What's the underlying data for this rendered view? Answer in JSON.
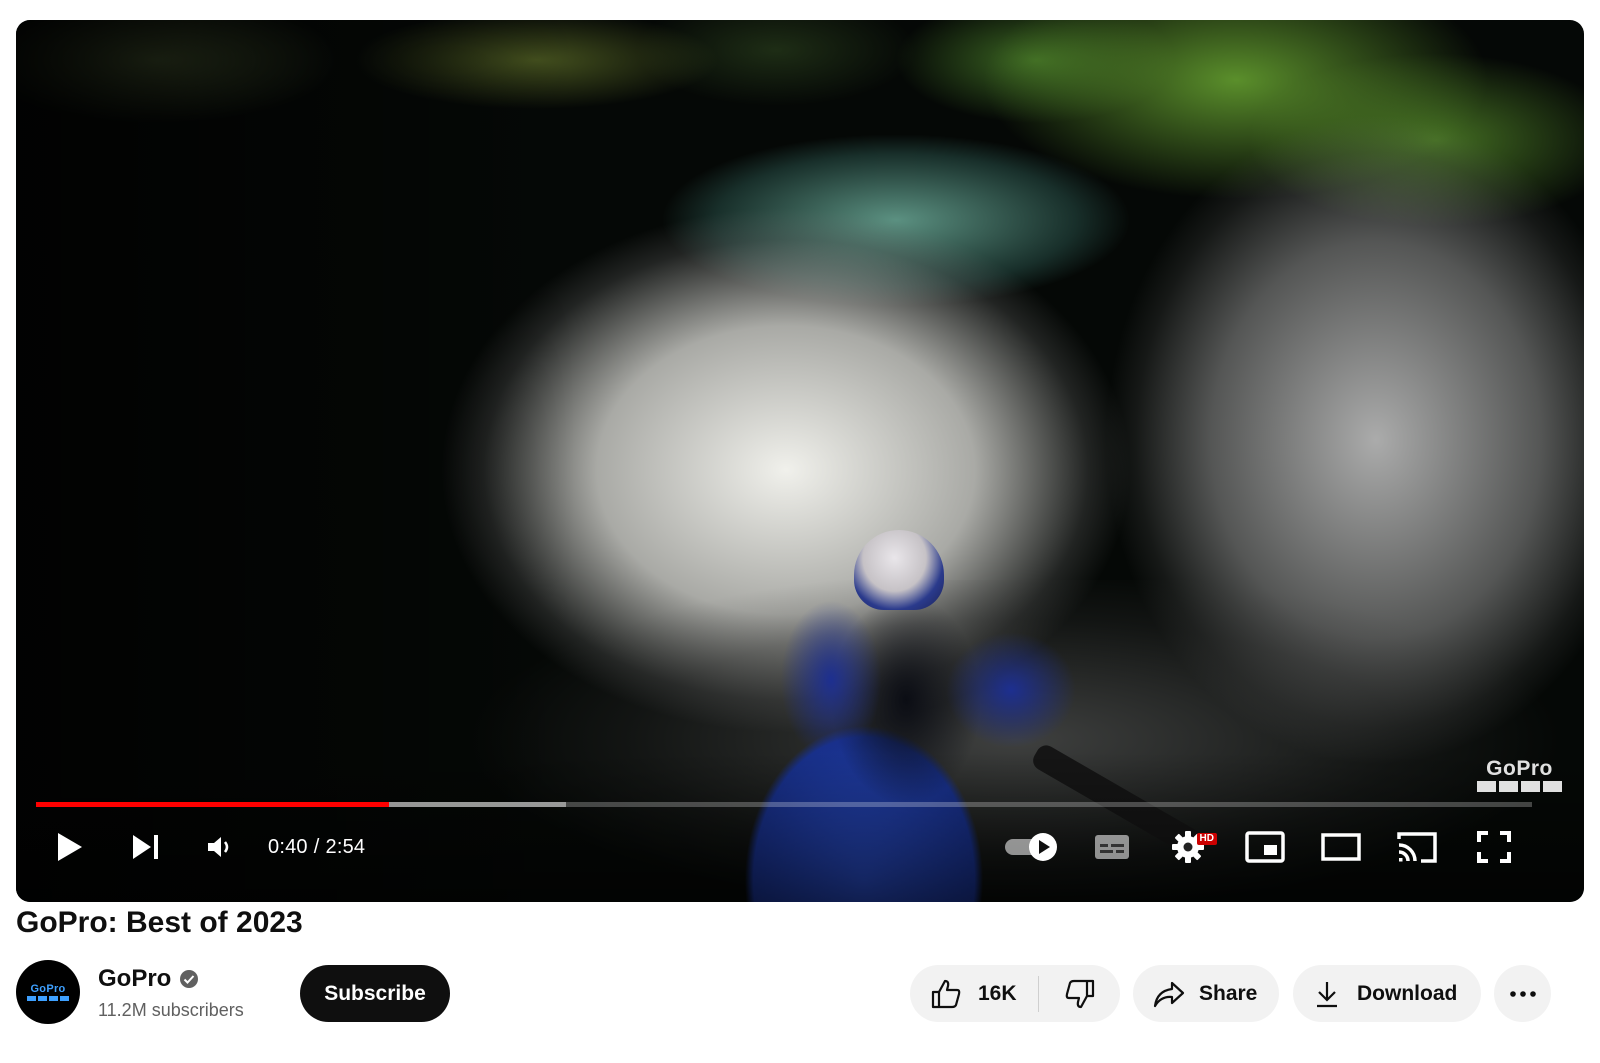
{
  "player": {
    "watermark": "GoPro",
    "progress": {
      "played_fraction": 0.236,
      "buffered_fraction": 0.354
    },
    "time": {
      "current": "0:40",
      "separator": "/",
      "duration": "2:54"
    },
    "hd_badge": "HD",
    "icons": {
      "play": "play-icon",
      "next": "skip-next-icon",
      "volume": "volume-icon",
      "autoplay": "autoplay-toggle-icon",
      "subtitles": "subtitles-icon",
      "settings": "gear-icon",
      "miniplayer": "miniplayer-icon",
      "theater": "theater-mode-icon",
      "cast": "cast-icon",
      "fullscreen": "fullscreen-icon"
    },
    "colors": {
      "progress_played": "#ff0000"
    }
  },
  "video": {
    "title": "GoPro: Best of 2023"
  },
  "channel": {
    "avatar_text": "GoPro",
    "name": "GoPro",
    "subscribers": "11.2M subscribers",
    "subscribe_label": "Subscribe"
  },
  "actions": {
    "like_count": "16K",
    "share_label": "Share",
    "download_label": "Download"
  }
}
